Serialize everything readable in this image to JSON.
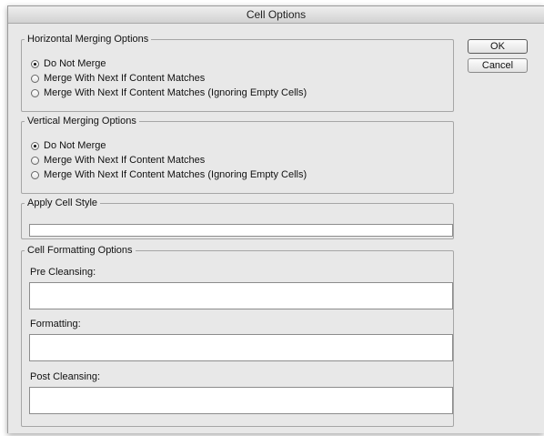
{
  "window": {
    "title": "Cell Options"
  },
  "buttons": {
    "ok": "OK",
    "cancel": "Cancel"
  },
  "horizontal": {
    "legend": "Horizontal Merging Options",
    "options": [
      "Do Not Merge",
      "Merge With Next If Content Matches",
      "Merge With Next If Content Matches (Ignoring Empty Cells)"
    ],
    "selected_index": 0
  },
  "vertical": {
    "legend": "Vertical Merging Options",
    "options": [
      "Do Not Merge",
      "Merge With Next If Content Matches",
      "Merge With Next If Content Matches (Ignoring Empty Cells)"
    ],
    "selected_index": 0
  },
  "cell_style": {
    "legend": "Apply Cell Style",
    "value": ""
  },
  "formatting": {
    "legend": "Cell Formatting Options",
    "pre_cleansing_label": "Pre Cleansing:",
    "pre_cleansing_value": "",
    "formatting_label": "Formatting:",
    "formatting_value": "",
    "post_cleansing_label": "Post Cleansing:",
    "post_cleansing_value": ""
  }
}
